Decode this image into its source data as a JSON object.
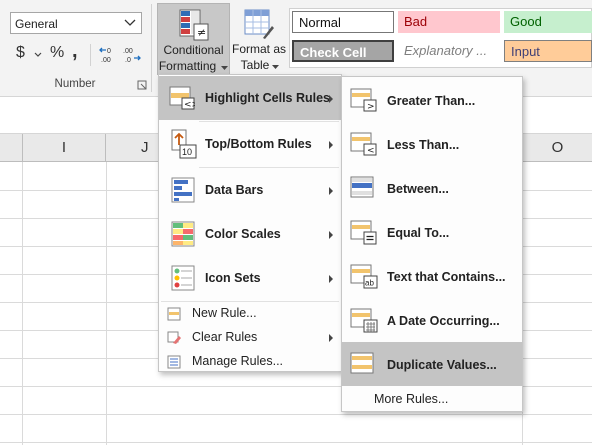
{
  "ribbon": {
    "number_format": "General",
    "currency": "$",
    "percent": "%",
    "comma": ",",
    "number_group_label": "Number",
    "conditional_formatting": {
      "line1": "Conditional",
      "line2": "Formatting"
    },
    "format_as_table": {
      "line1": "Format as",
      "line2": "Table"
    },
    "styles": {
      "normal": "Normal",
      "bad": "Bad",
      "good": "Good",
      "check_cell": "Check Cell",
      "explanatory": "Explanatory ...",
      "input": "Input"
    }
  },
  "sheet": {
    "col_headers": [
      "I",
      "J",
      "O"
    ]
  },
  "cf_menu": {
    "items": [
      {
        "label": "Highlight Cells Rules",
        "icon": "highlight-cells-icon"
      },
      {
        "label": "Top/Bottom Rules",
        "icon": "top-bottom-icon"
      },
      {
        "label": "Data Bars",
        "icon": "data-bars-icon"
      },
      {
        "label": "Color Scales",
        "icon": "color-scales-icon"
      },
      {
        "label": "Icon Sets",
        "icon": "icon-sets-icon"
      }
    ],
    "small_items": [
      {
        "label": "New Rule...",
        "icon": "new-rule-icon"
      },
      {
        "label": "Clear Rules",
        "icon": "clear-rules-icon"
      },
      {
        "label": "Manage Rules...",
        "icon": "manage-rules-icon"
      }
    ]
  },
  "submenu": {
    "items": [
      {
        "label": "Greater Than...",
        "icon": "greater-than-icon"
      },
      {
        "label": "Less Than...",
        "icon": "less-than-icon"
      },
      {
        "label": "Between...",
        "icon": "between-icon"
      },
      {
        "label": "Equal To...",
        "icon": "equal-to-icon"
      },
      {
        "label": "Text that Contains...",
        "icon": "text-contains-icon"
      },
      {
        "label": "A Date Occurring...",
        "icon": "date-occurring-icon"
      },
      {
        "label": "Duplicate Values...",
        "icon": "duplicate-values-icon"
      }
    ],
    "more_rules": "More Rules..."
  },
  "colors": {
    "highlight": "#c4c4c4",
    "bad_bg": "#ffc7ce",
    "bad_fg": "#9c0006",
    "good_bg": "#c6efce",
    "good_fg": "#006100",
    "input_bg": "#ffcc99",
    "input_fg": "#3f3f76",
    "check_bg": "#a5a5a5"
  }
}
